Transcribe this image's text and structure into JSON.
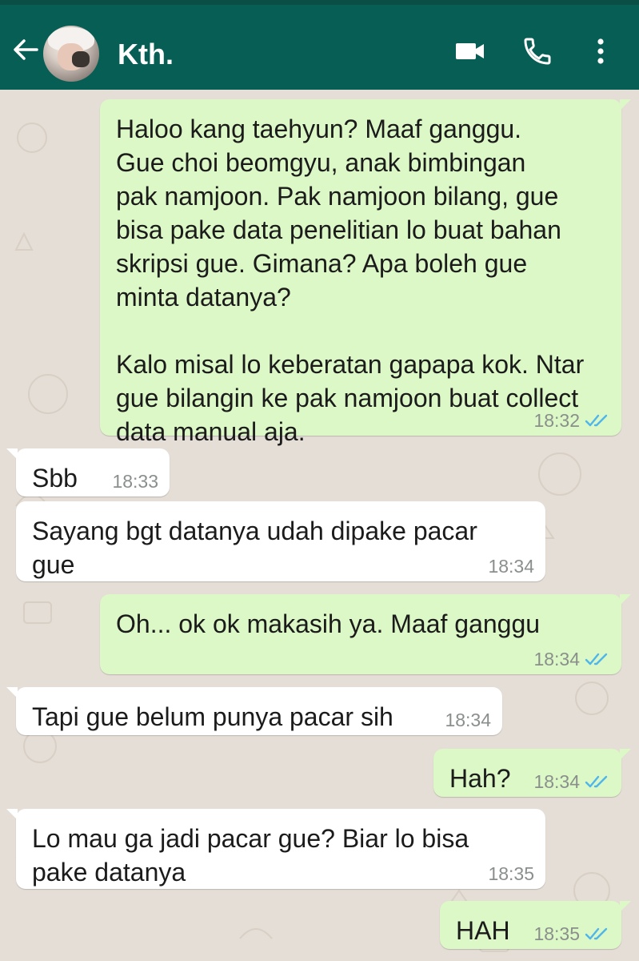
{
  "header": {
    "contact_name": "Kth."
  },
  "messages": [
    {
      "direction": "outgoing",
      "text": "Haloo kang taehyun? Maaf ganggu.\nGue choi beomgyu, anak bimbingan\npak namjoon. Pak namjoon bilang, gue\nbisa pake data penelitian lo buat bahan\nskripsi gue. Gimana? Apa boleh gue\nminta datanya?\n\nKalo misal lo keberatan gapapa kok. Ntar\ngue bilangin ke pak namjoon buat collect\ndata manual aja.",
      "time": "18:32",
      "status": "read"
    },
    {
      "direction": "incoming",
      "text": "Sbb",
      "time": "18:33"
    },
    {
      "direction": "incoming",
      "text": "Sayang bgt datanya udah dipake pacar\ngue",
      "time": "18:34"
    },
    {
      "direction": "outgoing",
      "text": "Oh... ok ok makasih ya. Maaf ganggu",
      "time": "18:34",
      "status": "read"
    },
    {
      "direction": "incoming",
      "text": "Tapi gue belum punya pacar sih",
      "time": "18:34"
    },
    {
      "direction": "outgoing",
      "text": "Hah?",
      "time": "18:34",
      "status": "read"
    },
    {
      "direction": "incoming",
      "text": "Lo mau ga jadi pacar gue? Biar lo bisa\npake datanya",
      "time": "18:35"
    },
    {
      "direction": "outgoing",
      "text": "HAH",
      "time": "18:35",
      "status": "read"
    }
  ],
  "colors": {
    "header_bg": "#075e54",
    "outgoing_bubble": "#dcf8c6",
    "incoming_bubble": "#ffffff",
    "read_tick": "#4fb6ec",
    "wallpaper": "#e5ded6"
  },
  "icons": [
    "back-arrow-icon",
    "video-call-icon",
    "voice-call-icon",
    "more-options-icon",
    "double-check-icon"
  ]
}
